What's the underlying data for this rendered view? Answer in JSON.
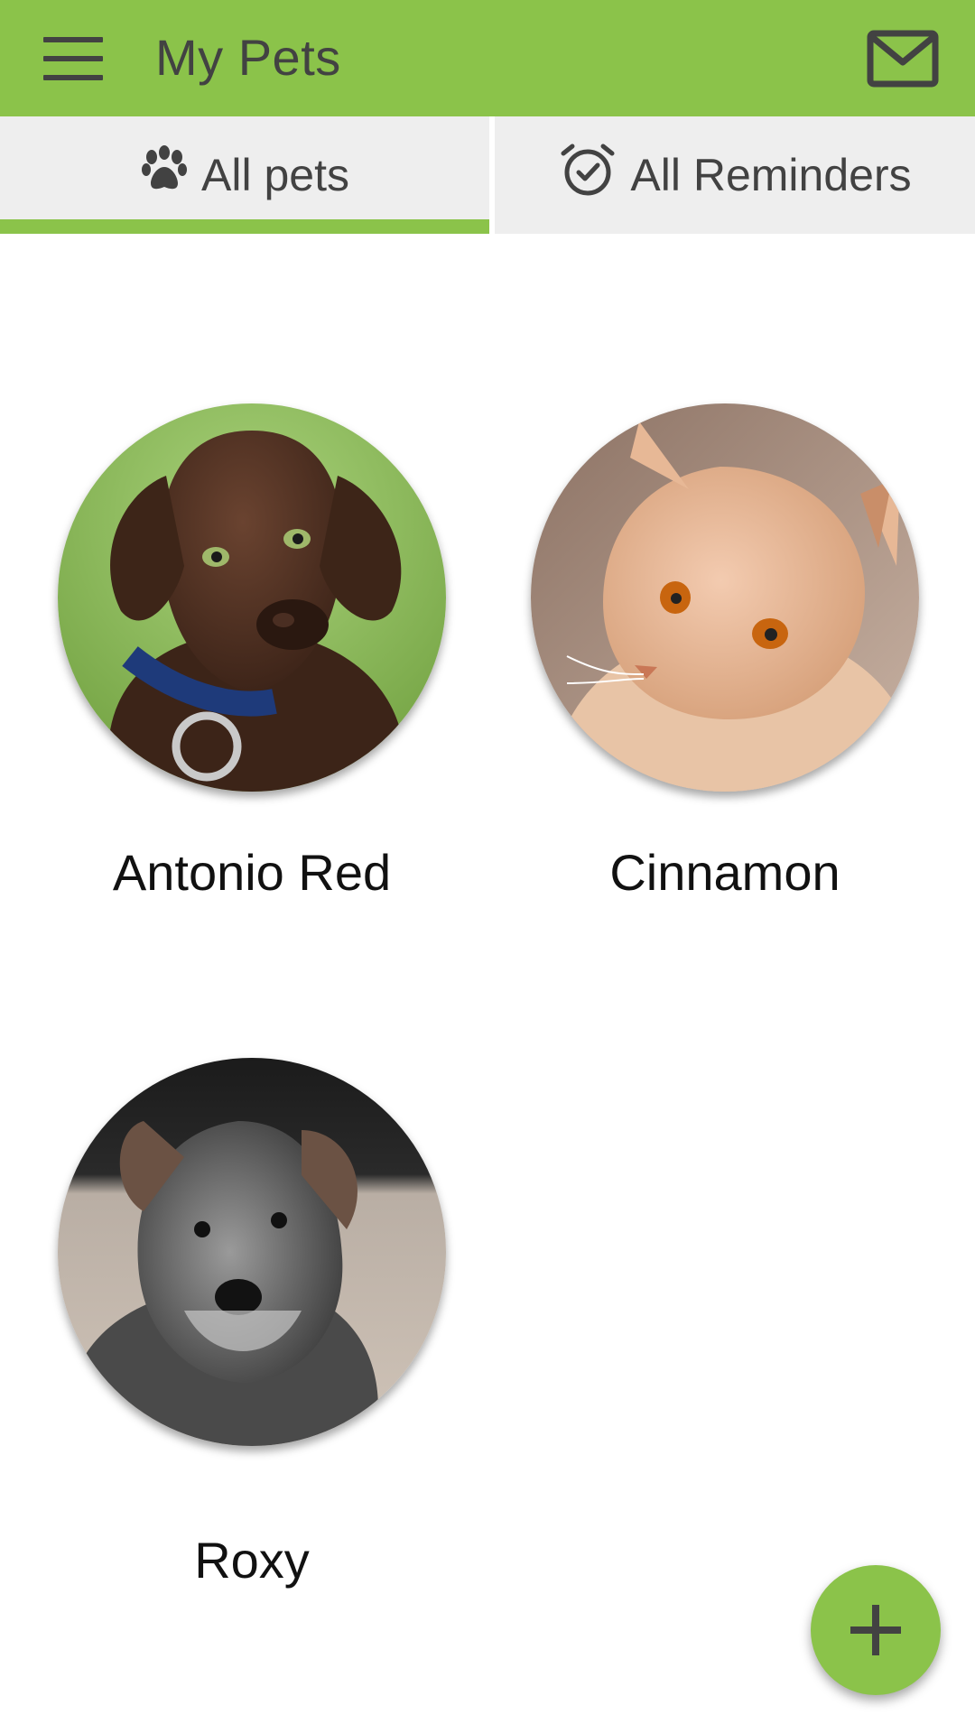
{
  "toolbar": {
    "title": "My Pets",
    "menu_icon": "hamburger-menu-icon",
    "mail_icon": "envelope-icon",
    "color": "#8bc34a"
  },
  "tabs": [
    {
      "label": "All pets",
      "icon": "paw-icon",
      "selected": true
    },
    {
      "label": "All Reminders",
      "icon": "alarm-check-icon",
      "selected": false
    }
  ],
  "pets": [
    {
      "name": "Antonio Red",
      "photo": "chocolate labrador puppy"
    },
    {
      "name": "Cinnamon",
      "photo": "orange tabby cat"
    },
    {
      "name": "Roxy",
      "photo": "schnauzer puppy"
    }
  ],
  "fab": {
    "icon": "plus-icon",
    "color": "#8bc34a"
  }
}
